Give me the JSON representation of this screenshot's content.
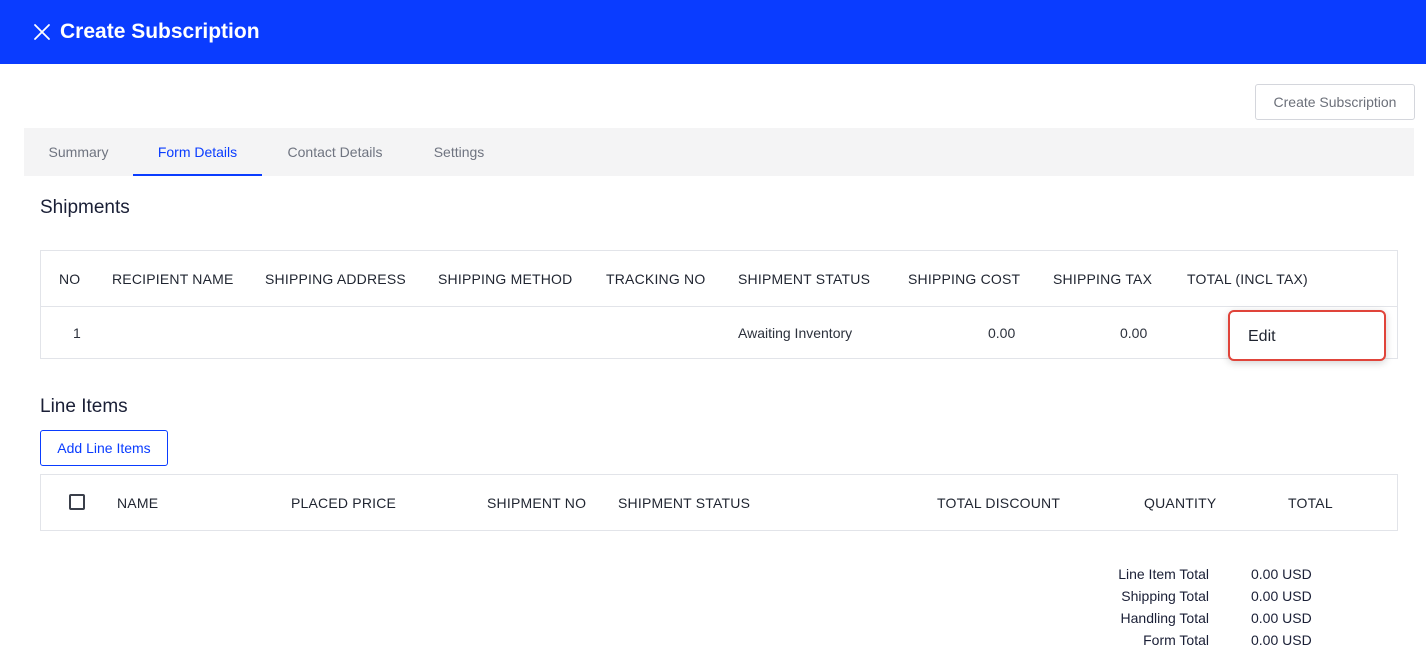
{
  "header": {
    "title": "Create Subscription",
    "close_icon": "close-icon"
  },
  "actions": {
    "create_subscription_label": "Create Subscription"
  },
  "tabs": [
    {
      "label": "Summary",
      "active": false
    },
    {
      "label": "Form Details",
      "active": true
    },
    {
      "label": "Contact Details",
      "active": false
    },
    {
      "label": "Settings",
      "active": false
    }
  ],
  "shipments": {
    "title": "Shipments",
    "columns": [
      "NO",
      "RECIPIENT NAME",
      "SHIPPING ADDRESS",
      "SHIPPING METHOD",
      "TRACKING NO",
      "SHIPMENT STATUS",
      "SHIPPING COST",
      "SHIPPING TAX",
      "TOTAL (INCL TAX)"
    ],
    "rows": [
      {
        "no": "1",
        "recipient_name": "",
        "shipping_address": "",
        "shipping_method": "",
        "tracking_no": "",
        "status": "Awaiting Inventory",
        "shipping_cost": "0.00",
        "shipping_tax": "0.00",
        "total": ""
      }
    ],
    "row_menu": {
      "edit_label": "Edit"
    }
  },
  "line_items": {
    "title": "Line Items",
    "add_button_label": "Add Line Items",
    "columns": [
      "NAME",
      "PLACED PRICE",
      "SHIPMENT NO",
      "SHIPMENT STATUS",
      "TOTAL DISCOUNT",
      "QUANTITY",
      "TOTAL"
    ]
  },
  "totals": [
    {
      "label": "Line Item Total",
      "value": "0.00 USD"
    },
    {
      "label": "Shipping Total",
      "value": "0.00 USD"
    },
    {
      "label": "Handling Total",
      "value": "0.00 USD"
    },
    {
      "label": "Form Total",
      "value": "0.00 USD"
    }
  ],
  "colors": {
    "brand_blue": "#0a3cff",
    "highlight_red": "#e0443a",
    "tab_bar_bg": "#f4f4f5"
  }
}
